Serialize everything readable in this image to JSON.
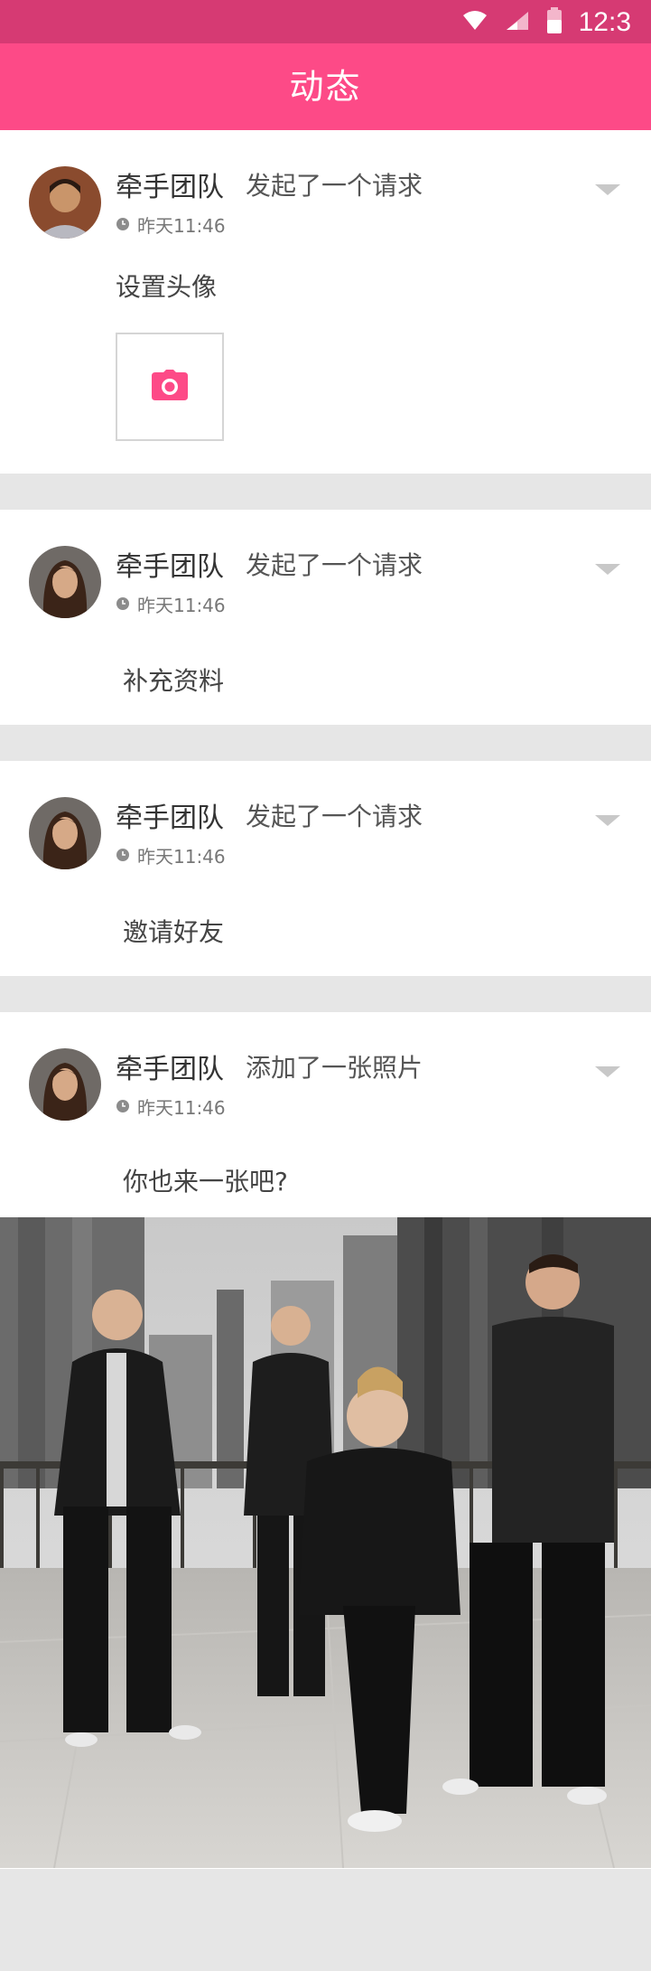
{
  "status_bar": {
    "time": "12:3"
  },
  "app_bar": {
    "title": "动态"
  },
  "feed": [
    {
      "user": "牵手团队",
      "action": "发起了一个请求",
      "time": "昨天11:46",
      "content": "设置头像"
    },
    {
      "user": "牵手团队",
      "action": "发起了一个请求",
      "time": "昨天11:46",
      "content": "补充资料"
    },
    {
      "user": "牵手团队",
      "action": "发起了一个请求",
      "time": "昨天11:46",
      "content": "邀请好友"
    },
    {
      "user": "牵手团队",
      "action": "添加了一张照片",
      "time": "昨天11:46",
      "content": "你也来一张吧?"
    }
  ],
  "colors": {
    "accent": "#fd4a87",
    "status_bar": "#d63a73",
    "divider": "#e6e6e6"
  },
  "icons": [
    "wifi-icon",
    "signal-icon",
    "battery-icon",
    "clock-icon",
    "chevron-down-icon",
    "camera-icon"
  ]
}
